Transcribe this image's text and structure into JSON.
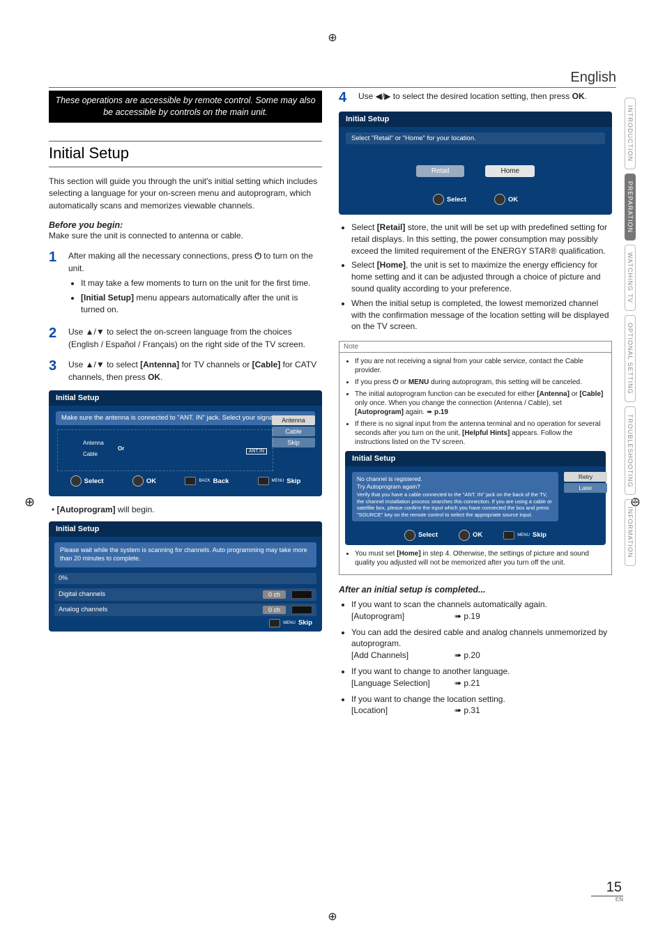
{
  "header": {
    "language": "English"
  },
  "side_tabs": [
    "INTRODUCTION",
    "PREPARATION",
    "WATCHING TV",
    "OPTIONAL SETTING",
    "TROUBLESHOOTING",
    "INFORMATION"
  ],
  "banner": "These operations are accessible by remote control. Some may also be accessible by controls on the main unit.",
  "section_title": "Initial Setup",
  "intro": "This section will guide you through the unit's initial setting which includes selecting a language for your on-screen menu and autoprogram, which automatically scans and memorizes viewable channels.",
  "before_heading": "Before you begin:",
  "before_text": "Make sure the unit is connected to antenna or cable.",
  "steps": {
    "s1": {
      "text_a": "After making all the necessary connections, press ",
      "text_b": " to turn on the unit.",
      "bullets": [
        "It may take a few moments to turn on the unit for the first time.",
        "[Initial Setup] menu appears automatically after the unit is turned on."
      ]
    },
    "s2": "Use ▲/▼ to select the on-screen language from the choices (English / Español / Français) on the right side of the TV screen.",
    "s3_a": "Use ▲/▼ to select ",
    "s3_b": " for TV channels or ",
    "s3_c": " for CATV channels, then press ",
    "s3_d": ".",
    "s4_a": "Use ◀/▶ to select the desired location setting, then press ",
    "s4_b": "."
  },
  "tv1": {
    "title": "Initial Setup",
    "instr": "Make sure the antenna is connected to \"ANT. IN\" jack. Select your signal source.",
    "options": [
      "Antenna",
      "Cable",
      "Skip"
    ],
    "diag": {
      "ant": "Antenna",
      "cab": "Cable",
      "or": "Or",
      "jack": "ANT.IN"
    },
    "footer": [
      "Select",
      "OK",
      "Back",
      "Skip"
    ],
    "footnote_back": "BACK",
    "footnote_menu": "MENU"
  },
  "autoprogram_note": "• [Autoprogram] will begin.",
  "tv2": {
    "title": "Initial Setup",
    "msg": "Please wait while the system is scanning for channels. Auto programming may take more than 20 minutes to complete.",
    "pct": "0%",
    "rows": [
      {
        "label": "Digital channels",
        "count": "0 ch"
      },
      {
        "label": "Analog channels",
        "count": "0 ch"
      }
    ],
    "footer_menu": "MENU",
    "footer": "Skip"
  },
  "tv3": {
    "title": "Initial Setup",
    "instr": "Select \"Retail\" or \"Home\" for your location.",
    "opts": [
      "Retail",
      "Home"
    ],
    "footer": [
      "Select",
      "OK"
    ]
  },
  "loc_bullets": [
    "Select [Retail] store, the unit will be set up with predefined setting for retail displays. In this setting, the power consumption may possibly exceed the limited requirement of the ENERGY STAR® qualification.",
    "Select [Home], the unit is set to maximize the energy efficiency for home setting and it can be adjusted through a choice of picture and sound quality according to your preference.",
    "When the initial setup is completed, the lowest memorized channel with the confirmation message of the location setting will be displayed on the TV screen."
  ],
  "note_title": "Note",
  "notes": [
    "If you are not receiving a signal from your cable service, contact the Cable provider.",
    "If you press ⏻ or MENU during autoprogram, this setting will be canceled.",
    "The initial autoprogram function can be executed for either [Antenna] or [Cable] only once. When you change the connection (Antenna / Cable), set [Autoprogram] again. ➠ p.19",
    "If there is no signal input from the antenna terminal and no operation for several seconds after you turn on the unit, [Helpful Hints] appears. Follow the instructions listed on the TV screen."
  ],
  "tv4": {
    "title": "Initial Setup",
    "msg_l1": "No channel is registered.",
    "msg_l2": "Try Autoprogram again?",
    "body": "Verify that you have a cable connected to the \"ANT. IN\" jack on the back of the TV, the channel installation process searches this connection. If you are using a cable or satellite box, please confirm the input which you have connected the box and press \"SOURCE\" key on the remote control to select the appropriate source input.",
    "opts": [
      "Retry",
      "Later"
    ],
    "footer": [
      "Select",
      "OK",
      "Skip"
    ],
    "footer_menu": "MENU"
  },
  "post_note": "You must set [Home] in step 4. Otherwise, the settings of picture and sound quality you adjusted will not be memorized after you turn off the unit.",
  "after_heading": "After an initial setup is completed...",
  "after": [
    {
      "text": "If you want to scan the channels automatically again.",
      "label": "[Autoprogram]",
      "page": "➠ p.19"
    },
    {
      "text": "You can add the desired cable and analog channels unmemorized by autoprogram.",
      "label": "[Add Channels]",
      "page": "➠ p.20"
    },
    {
      "text": "If you want to change to another language.",
      "label": "[Language Selection]",
      "page": "➠ p.21"
    },
    {
      "text": "If you want to change the location setting.",
      "label": "[Location]",
      "page": "➠ p.31"
    }
  ],
  "page_number": "15",
  "page_en": "EN",
  "icons": {
    "power": "⏻",
    "arrow": "➠"
  }
}
